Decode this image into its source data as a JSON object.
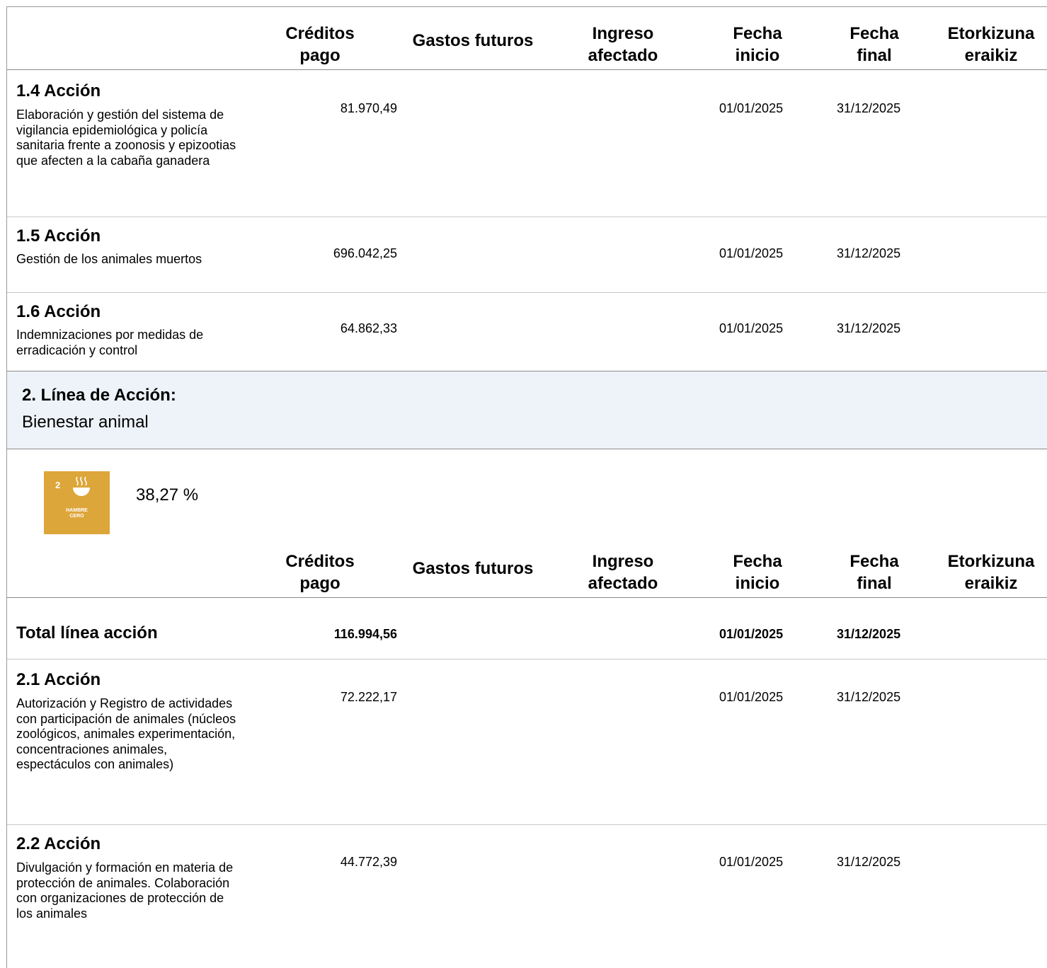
{
  "headers": {
    "creditos": "Créditos\npago",
    "gastos": "Gastos futuros",
    "ingreso": "Ingreso\nafectado",
    "fecha_inicio": "Fecha\ninicio",
    "fecha_final": "Fecha\nfinal",
    "etorkizuna": "Etorkizuna\neraikiz"
  },
  "actions_1": [
    {
      "title": "1.4 Acción",
      "desc": "Elaboración y gestión del sistema de vigilancia epidemiológica y policía sanitaria frente a zoonosis y epizootias que afecten a la cabaña ganadera",
      "creditos": "81.970,49",
      "fecha_inicio": "01/01/2025",
      "fecha_final": "31/12/2025"
    },
    {
      "title": "1.5 Acción",
      "desc": "Gestión de los animales muertos",
      "creditos": "696.042,25",
      "fecha_inicio": "01/01/2025",
      "fecha_final": "31/12/2025"
    },
    {
      "title": "1.6 Acción",
      "desc": "Indemnizaciones por medidas de erradicación y control",
      "creditos": "64.862,33",
      "fecha_inicio": "01/01/2025",
      "fecha_final": "31/12/2025"
    }
  ],
  "line2": {
    "heading": "2. Línea de Acción:",
    "name": "Bienestar animal",
    "sdg": {
      "number": "2",
      "label": "HAMBRE\nCERO",
      "color": "#dda63a",
      "icon": "bowl-icon"
    },
    "percent": "38,27 %"
  },
  "total": {
    "label": "Total línea acción",
    "creditos": "116.994,56",
    "fecha_inicio": "01/01/2025",
    "fecha_final": "31/12/2025"
  },
  "actions_2": [
    {
      "title": "2.1 Acción",
      "desc": "Autorización y Registro de actividades con participación de animales (núcleos zoológicos, animales experimentación, concentraciones animales, espectáculos con animales)",
      "creditos": "72.222,17",
      "fecha_inicio": "01/01/2025",
      "fecha_final": "31/12/2025"
    },
    {
      "title": "2.2 Acción",
      "desc": "Divulgación y formación en materia de protección de animales. Colaboración con organizaciones de protección de los animales",
      "creditos": "44.772,39",
      "fecha_inicio": "01/01/2025",
      "fecha_final": "31/12/2025"
    }
  ]
}
